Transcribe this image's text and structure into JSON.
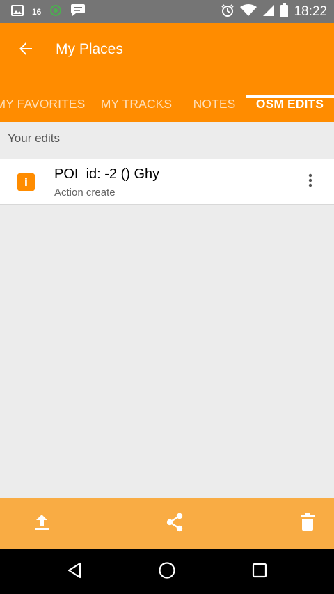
{
  "status_bar": {
    "notification_count": "16",
    "time": "18:22",
    "icons": [
      "image-icon",
      "notification-16-icon",
      "sync-icon",
      "chat-icon",
      "alarm-icon",
      "wifi-icon",
      "signal-icon",
      "battery-icon"
    ]
  },
  "app_bar": {
    "title": "My Places",
    "back_icon": "arrow-back-icon",
    "background_color": "#ff8c00"
  },
  "tabs": [
    {
      "label": "MY FAVORITES",
      "active": false
    },
    {
      "label": "MY TRACKS",
      "active": false
    },
    {
      "label": "NOTES",
      "active": false
    },
    {
      "label": "OSM EDITS",
      "active": true
    }
  ],
  "section": {
    "label": "Your edits"
  },
  "edits": [
    {
      "icon": "info-icon",
      "icon_glyph": "i",
      "title": "POI  id: -2 () Ghy",
      "subtitle": "Action create",
      "menu_icon": "more-vert-icon"
    }
  ],
  "toolbar": {
    "background_color": "#f9ac44",
    "buttons": [
      "upload-icon",
      "share-icon",
      "delete-icon"
    ]
  },
  "nav_bar": {
    "buttons": [
      "back-triangle-icon",
      "home-circle-icon",
      "recents-square-icon"
    ]
  }
}
